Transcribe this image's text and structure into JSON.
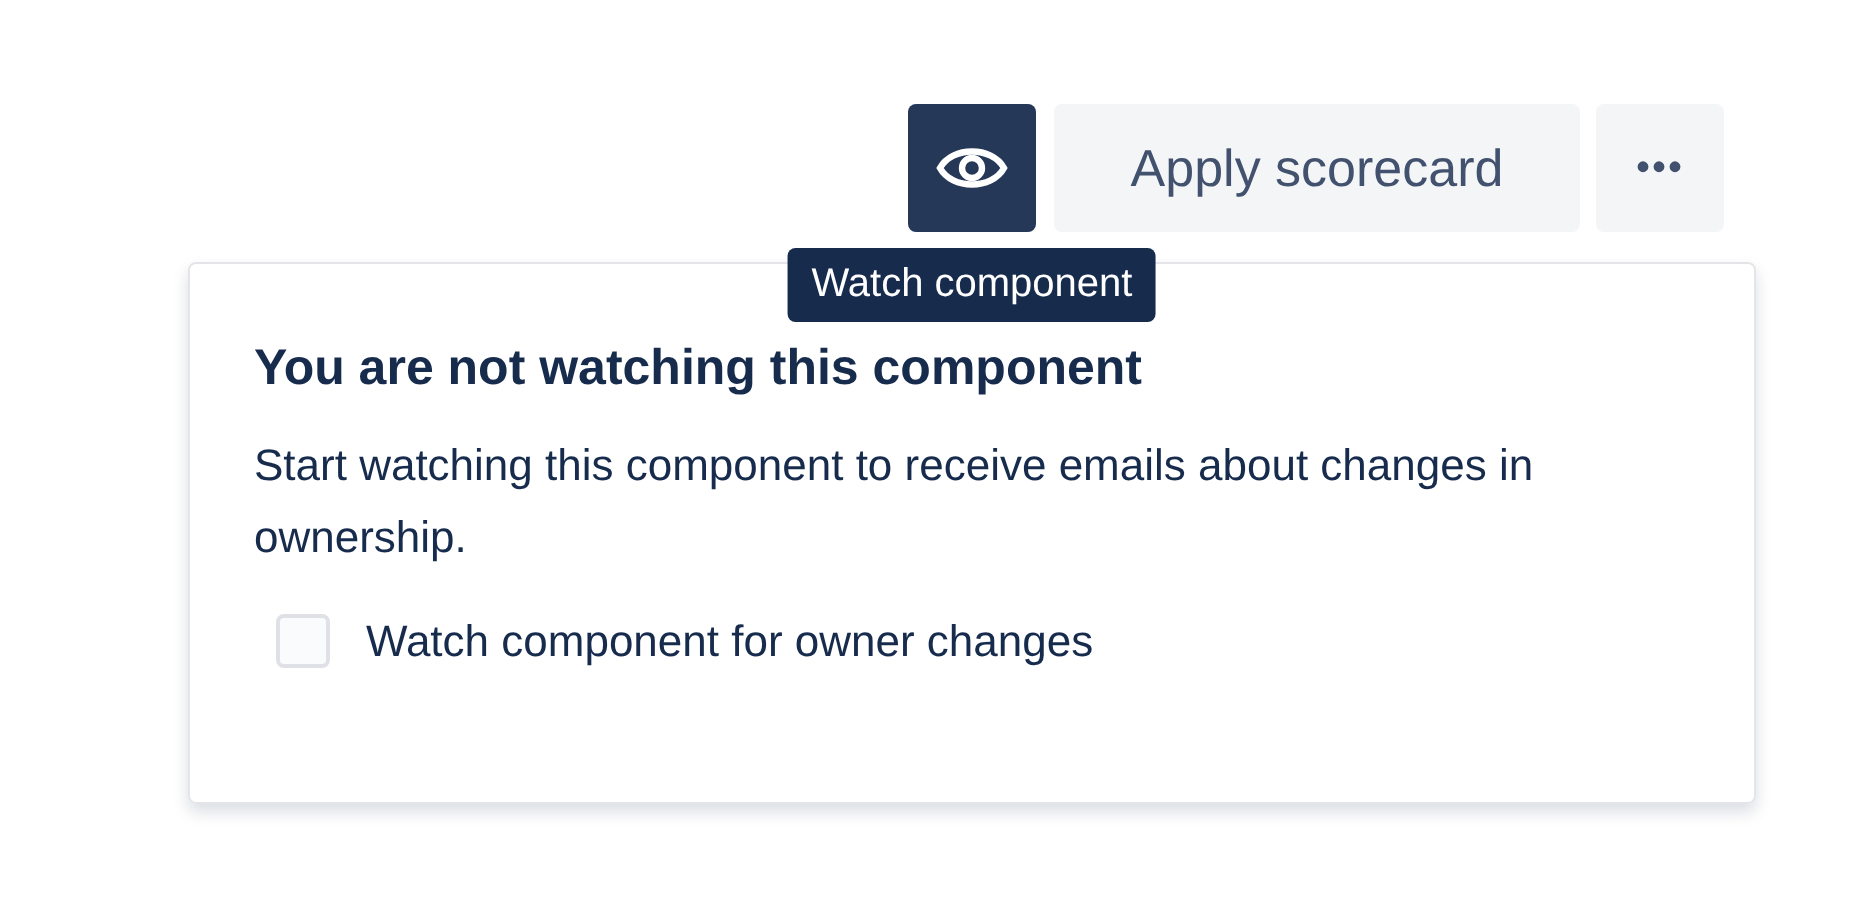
{
  "toolbar": {
    "watch_button": {
      "selected": true,
      "tooltip": "Watch component"
    },
    "apply_button": "Apply scorecard",
    "more_button": "•••"
  },
  "popup": {
    "title": "You are not watching this component",
    "description": "Start watching this component to receive emails about changes in ownership.",
    "checkbox": {
      "label": "Watch component for owner changes",
      "checked": false
    }
  }
}
